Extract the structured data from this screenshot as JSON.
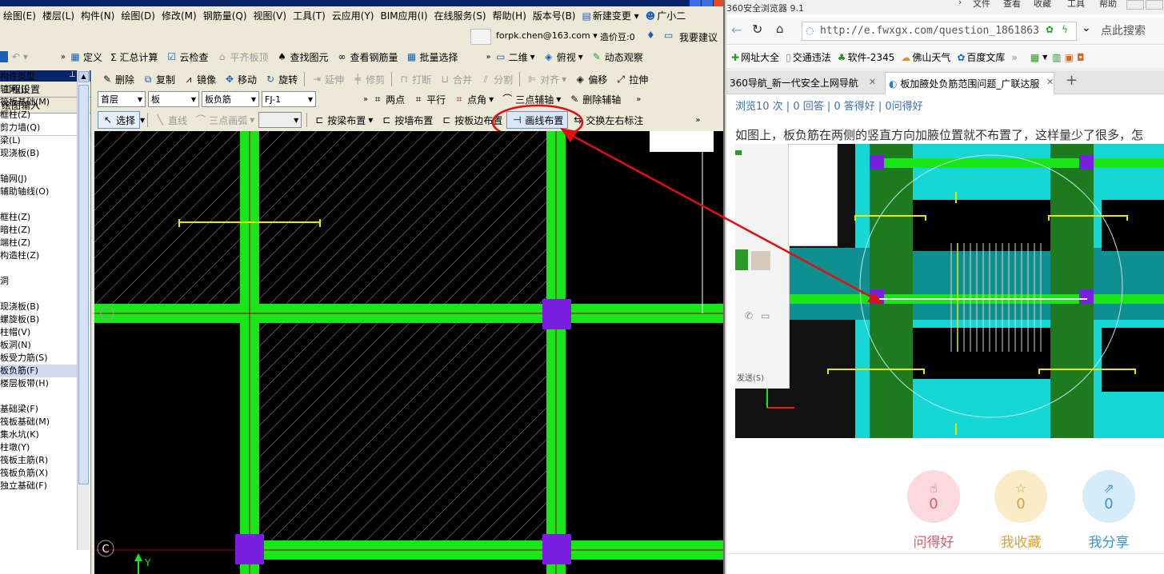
{
  "cad": {
    "menu": [
      "绘图(E)",
      "楼层(L)",
      "构件(N)",
      "绘图(D)",
      "修改(M)",
      "钢筋量(Q)",
      "视图(V)",
      "工具(T)",
      "云应用(Y)",
      "BIM应用(I)",
      "在线服务(S)",
      "帮助(H)",
      "版本号(B)",
      "新建变更 ▾",
      "广小二"
    ],
    "user_email": "forpk.chen@163.com ▾",
    "price_beans": "造价豆:0",
    "suggest": "我要建议",
    "toolbar1": [
      "定义",
      "Σ 汇总计算",
      "云检查",
      "平齐板顶",
      "查找图元",
      "查看钢筋量",
      "批量选择",
      "二维",
      "俯视",
      "动态观察"
    ],
    "toolbar2": [
      "删除",
      "复制",
      "镜像",
      "移动",
      "旋转",
      "延伸",
      "修剪",
      "打断",
      "合并",
      "分割",
      "对齐",
      "偏移",
      "拉伸"
    ],
    "floor_combo": "首层",
    "type_combo": "板",
    "sub_combo": "板负筋",
    "item_combo": "FJ-1",
    "toolbar3": [
      "两点",
      "平行",
      "点角",
      "三点辅轴",
      "删除辅轴"
    ],
    "toolbar4": [
      "选择",
      "直线",
      "三点画弧",
      "按梁布置",
      "按墙布置",
      "按板边布置",
      "画线布置",
      "交换左右标注"
    ],
    "panel_buttons": [
      "工程设置",
      "绘图输入"
    ],
    "tree": [
      "构件类型",
      "轴网(J)",
      "筏板基础(M)",
      "框柱(Z)",
      "剪力墙(Q)",
      "梁(L)",
      "现浇板(B)",
      "",
      "轴网(J)",
      "辅助轴线(O)",
      "",
      "框柱(Z)",
      "暗柱(Z)",
      "端柱(Z)",
      "构造柱(Z)",
      "",
      "洞",
      "",
      "现浇板(B)",
      "螺旋板(B)",
      "柱帽(V)",
      "板洞(N)",
      "板受力筋(S)",
      "板负筋(F)",
      "楼层板带(H)",
      "",
      "基础梁(F)",
      "筏板基础(M)",
      "集水坑(K)",
      "柱墩(Y)",
      "筏板主筋(R)",
      "筏板负筋(X)",
      "独立基础(F)"
    ],
    "axis_c": "C",
    "axis_y": "Y"
  },
  "browser": {
    "title": "360安全浏览器 9.1",
    "menus": [
      "文件",
      "查看",
      "收藏",
      "工具",
      "帮助"
    ],
    "url": "http://e.fwxgx.com/question_1861863",
    "search_hint": "点此搜索",
    "favorites": [
      "网址大全",
      "交通违法",
      "软件-2345",
      "佛山天气",
      "百度文库"
    ],
    "tabs": [
      "360导航_新一代安全上网导航",
      "板加腋处负筋范围问题_广联达服"
    ],
    "stats": "浏览10 次 | 0 回答 | 0 答得好 | 0问得好",
    "question": "如图上，板负筋在两侧的竖直方向加腋位置就不布置了，这样量少了很多，怎",
    "send_label": "发送(S)",
    "actions": [
      {
        "label": "问得好",
        "count": "0"
      },
      {
        "label": "我收藏",
        "count": "0"
      },
      {
        "label": "我分享",
        "count": "0"
      }
    ]
  }
}
